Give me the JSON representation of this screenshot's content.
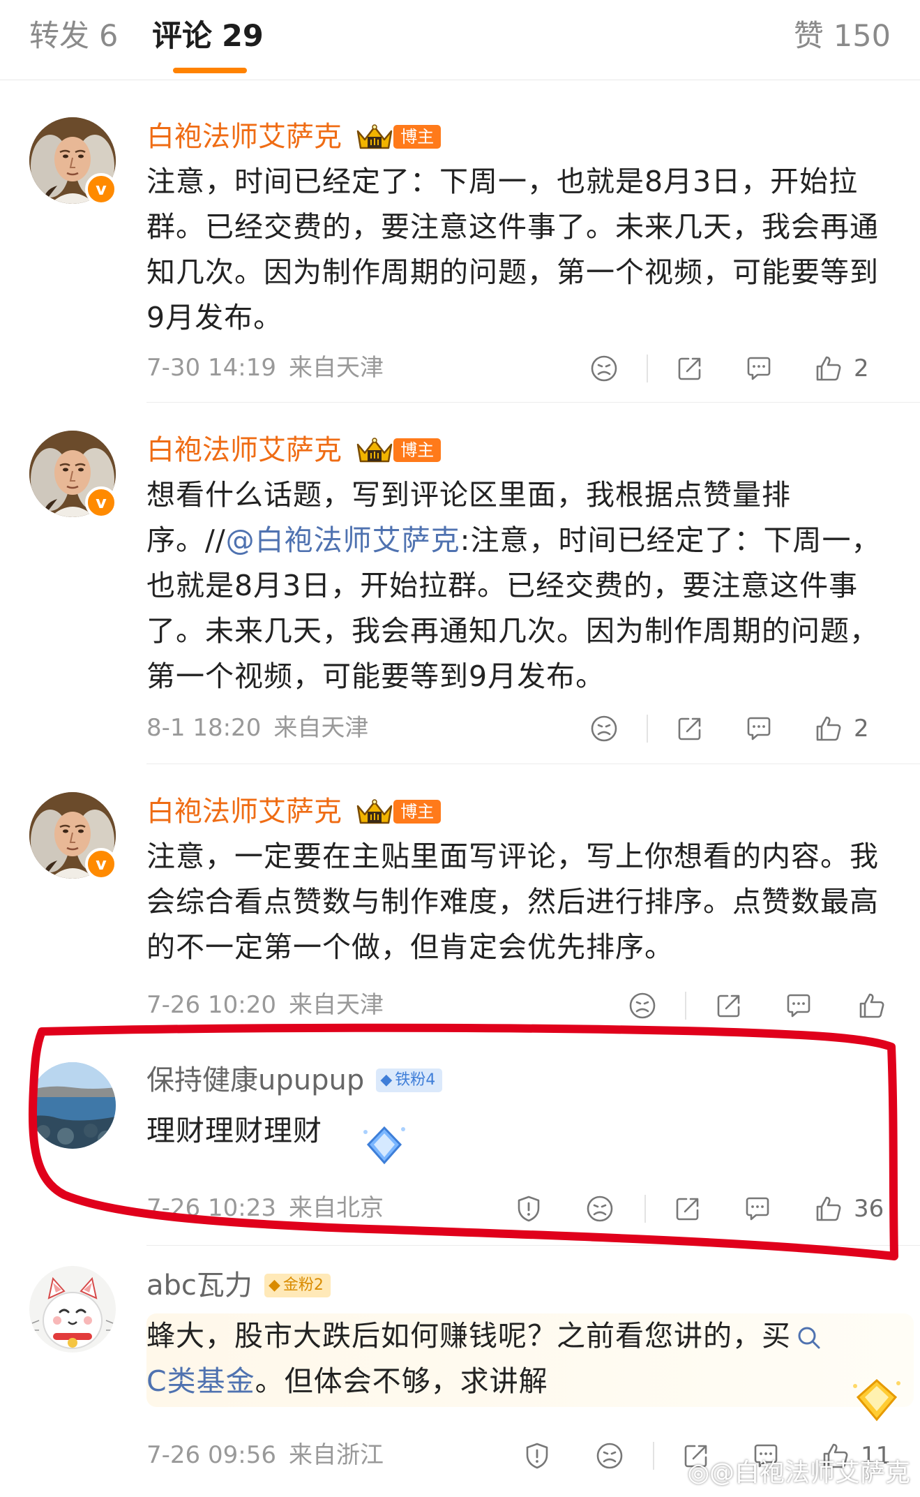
{
  "tabs": {
    "repost": {
      "label": "转发",
      "count": "6"
    },
    "comment": {
      "label": "评论",
      "count": "29"
    },
    "like": {
      "label": "赞",
      "count": "150"
    }
  },
  "colors": {
    "accent": "#ff8200",
    "username_orange": "#ef6c14",
    "link_blue": "#4f72b0",
    "annotation_red": "#e0001b"
  },
  "comments": [
    {
      "username": "白袍法师艾萨克",
      "tag": "博主",
      "text": "注意，时间已经定了：下周一，也就是8月3日，开始拉群。已经交费的，要注意这件事了。未来几天，我会再通知几次。因为制作周期的问题，第一个视频，可能要等到9月发布。",
      "time": "7-30 14:19",
      "location": "来自天津",
      "likes": "2"
    },
    {
      "username": "白袍法师艾萨克",
      "tag": "博主",
      "text_before": "想看什么话题，写到评论区里面，我根据点赞量排序。//",
      "mention": "@白袍法师艾萨克",
      "text_after": ":注意，时间已经定了：下周一，也就是8月3日，开始拉群。已经交费的，要注意这件事了。未来几天，我会再通知几次。因为制作周期的问题，第一个视频，可能要等到9月发布。",
      "time": "8-1 18:20",
      "location": "来自天津",
      "likes": "2"
    },
    {
      "username": "白袍法师艾萨克",
      "tag": "博主",
      "text": "注意，一定要在主贴里面写评论，写上你想看的内容。我会综合看点赞数与制作难度，然后进行排序。点赞数最高的不一定第一个做，但肯定会优先排序。",
      "time": "7-26 10:20",
      "location": "来自天津",
      "likes": ""
    },
    {
      "username": "保持健康upupup",
      "fan_badge": "铁粉4",
      "text": "理财理财理财",
      "time": "7-26 10:23",
      "location": "来自北京",
      "likes": "36"
    },
    {
      "username": "abc瓦力",
      "fan_badge": "金粉2",
      "text_line1": "蜂大，股市大跌后如何赚钱呢？之前看您讲的，买",
      "link_text": "C类基金",
      "text_line2": "。但体会不够，求讲解",
      "time": "7-26 09:56",
      "location": "来自浙江",
      "likes": "11"
    }
  ],
  "icons": {
    "dislike": "frown-face-icon",
    "repost": "share-arrow-icon",
    "comment": "speech-bubble-icon",
    "like": "thumbs-up-icon",
    "report": "shield-alert-icon",
    "search": "search-icon"
  },
  "watermark": "@白袍法师艾萨克"
}
